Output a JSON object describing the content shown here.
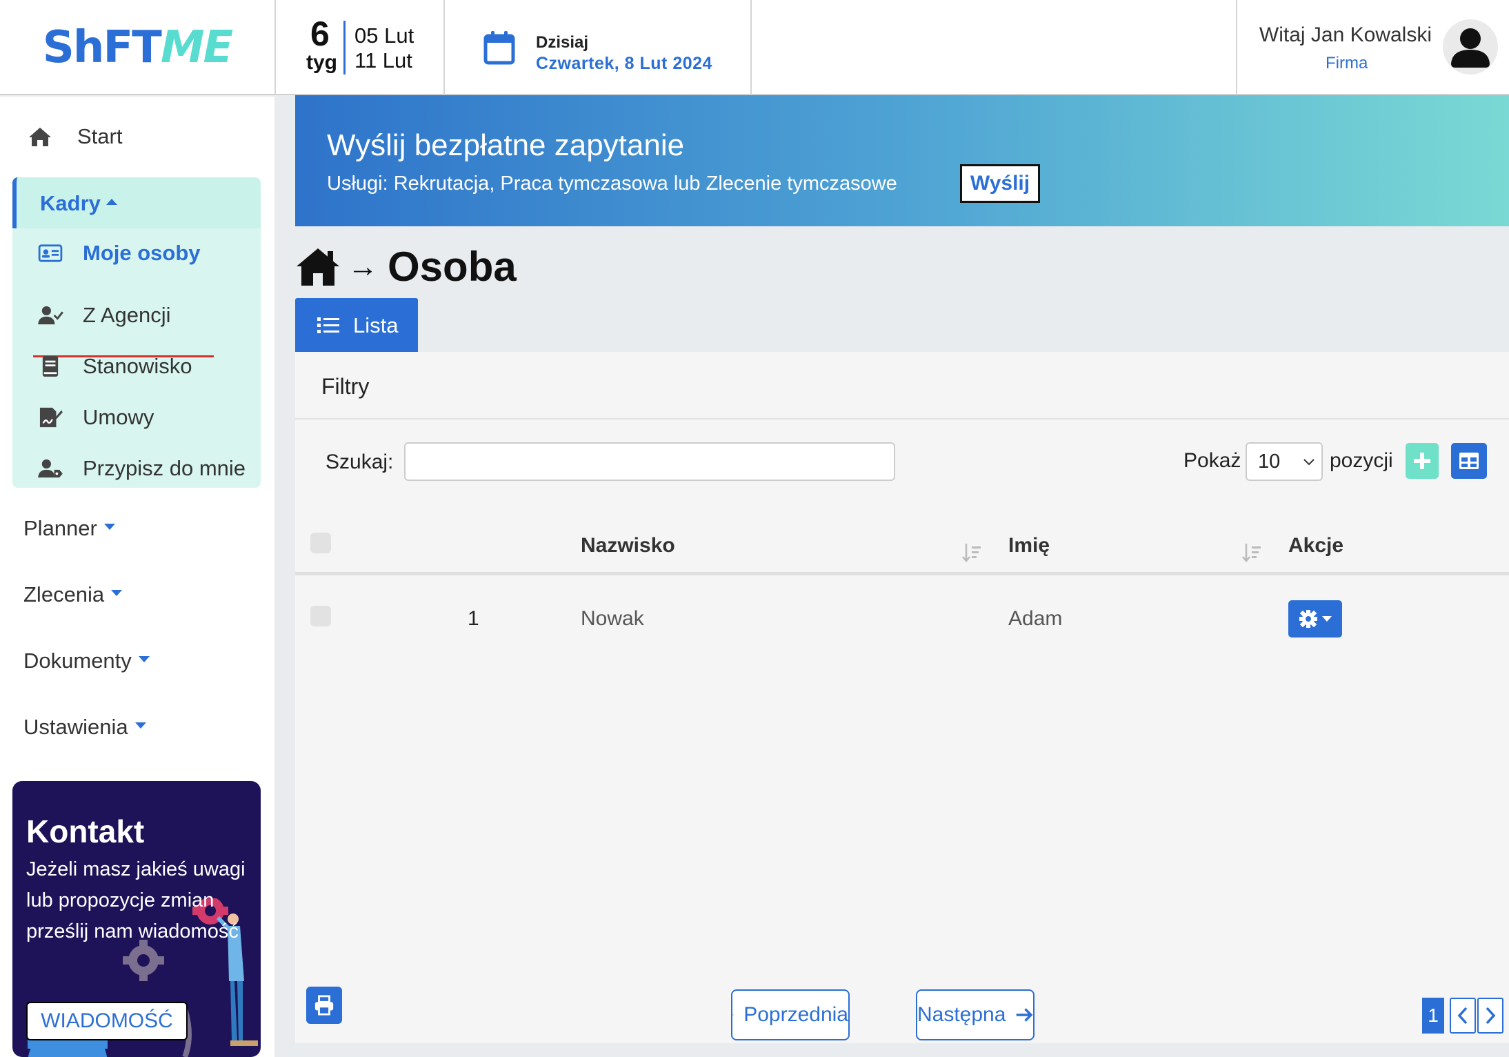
{
  "header": {
    "logo_part1": "ShFT",
    "logo_part2": "ME",
    "week_number": "6",
    "week_label": "tyg",
    "week_start": "05 Lut",
    "week_end": "11 Lut",
    "today_label": "Dzisiaj",
    "today_date": "Czwartek, 8 Lut 2024",
    "greeting": "Witaj Jan Kowalski",
    "role": "Firma"
  },
  "sidebar": {
    "start_label": "Start",
    "kadry_label": "Kadry",
    "kadry_items": [
      {
        "label": "Moje osoby",
        "icon": "id-card-icon"
      },
      {
        "label": "Z Agencji",
        "icon": "user-check-icon"
      },
      {
        "label": "Stanowisko",
        "icon": "book-icon"
      },
      {
        "label": "Umowy",
        "icon": "signature-icon"
      },
      {
        "label": "Przypisz do mnie",
        "icon": "user-tag-icon"
      }
    ],
    "groups": [
      "Planner",
      "Zlecenia",
      "Dokumenty",
      "Ustawienia"
    ],
    "contact": {
      "title": "Kontakt",
      "text": "Jeżeli masz jakieś uwagi lub propozycje zmian prześlij nam wiadomość",
      "button": "WIADOMOŚĆ"
    }
  },
  "banner": {
    "title": "Wyślij bezpłatne zapytanie",
    "subtitle": "Usługi: Rekrutacja, Praca tymczasowa lub Zlecenie tymczasowe",
    "button": "Wyślij"
  },
  "page": {
    "breadcrumb_arrow": "→",
    "title": "Osoba",
    "tab_label": "Lista",
    "filters_label": "Filtry",
    "search_label": "Szukaj:",
    "search_value": "",
    "show_label": "Pokaż",
    "show_value": "10",
    "positions_label": "pozycji"
  },
  "table": {
    "columns": [
      "Nazwisko",
      "Imię",
      "Akcje"
    ],
    "rows": [
      {
        "index": "1",
        "nazwisko": "Nowak",
        "imie": "Adam"
      }
    ]
  },
  "pagination": {
    "prev": "Poprzednia",
    "next": "Następna",
    "current_page": "1"
  },
  "colors": {
    "accent": "#2b6fd6",
    "mint": "#70e1c9",
    "contact_bg": "#1e1259"
  }
}
